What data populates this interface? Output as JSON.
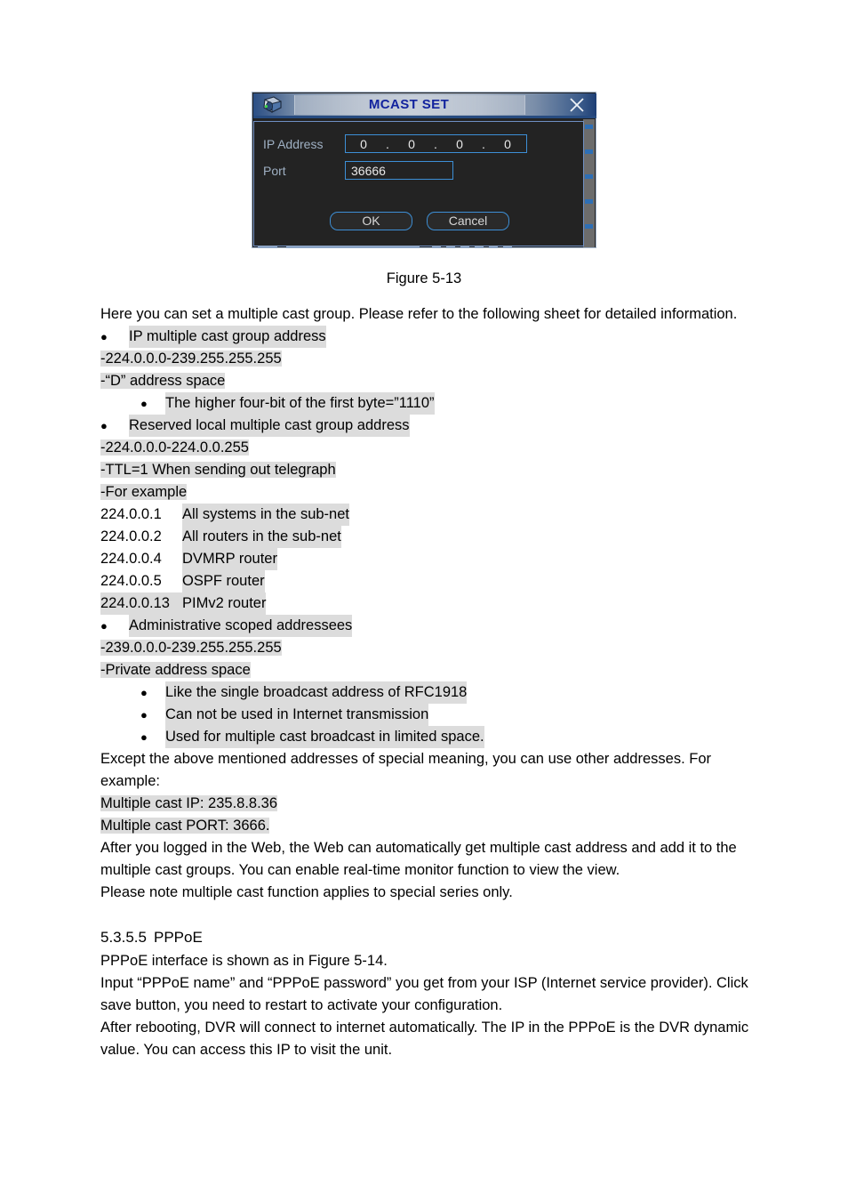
{
  "dialog": {
    "title": "MCAST SET",
    "icon": "network-device-icon",
    "close_icon": "close-icon",
    "fields": [
      {
        "label": "IP Address",
        "name": "ip-address",
        "type": "ip",
        "octets": [
          "0",
          "0",
          "0",
          "0"
        ],
        "separator": "."
      },
      {
        "label": "Port",
        "name": "port",
        "type": "text",
        "value": "36666"
      }
    ],
    "buttons": [
      {
        "label": "OK",
        "name": "ok-button"
      },
      {
        "label": "Cancel",
        "name": "cancel-button"
      }
    ],
    "colors": {
      "title_text": "#12239e",
      "field_border": "#3d8fd6",
      "panel_bg": "#232323",
      "label_text": "#9fb0c3"
    }
  },
  "figure_caption": "Figure 5-13",
  "body": {
    "intro": "Here you can set a multiple cast group. Please refer to the following sheet for detailed information.",
    "b1": "IP multiple cast group address",
    "l1": "-224.0.0.0-239.255.255.255",
    "l2": "-“D” address space",
    "b1a": "The higher four-bit of the first byte=”1110”",
    "b2": "Reserved local multiple cast group address",
    "l3": "-224.0.0.0-224.0.0.255",
    "l4": "-TTL=1 When sending out telegraph",
    "l5": "-For example",
    "addresses": [
      {
        "ip": "224.0.0.1",
        "desc": "All systems in the sub-net",
        "ip_highlighted": false
      },
      {
        "ip": "224.0.0.2",
        "desc": "All routers in the sub-net",
        "ip_highlighted": false
      },
      {
        "ip": "224.0.0.4",
        "desc": "DVMRP router",
        "ip_highlighted": false
      },
      {
        "ip": "224.0.0.5",
        "desc": "OSPF router",
        "ip_highlighted": false
      },
      {
        "ip": "224.0.0.13",
        "desc": "PIMv2 router",
        "ip_highlighted": true
      }
    ],
    "b3": "Administrative scoped addressees",
    "l6": "-239.0.0.0-239.255.255.255",
    "l7": "-Private address space",
    "b3a": "Like the single broadcast address of RFC1918",
    "b3b": "Can not be used in Internet transmission",
    "b3c": "Used for multiple cast broadcast in limited space.",
    "p_except": "Except the above mentioned addresses of special meaning, you can use other addresses. For example:",
    "mcast_ip": "Multiple cast IP: 235.8.8.36",
    "mcast_port": "Multiple cast PORT: 3666.",
    "p_after_login": "After you logged in the Web, the Web can automatically get multiple cast address and add it to the multiple cast groups. You can enable real-time monitor function to view the view.",
    "p_note": "Please note multiple cast function applies to special series only."
  },
  "section": {
    "number": "5.3.5.5",
    "title": "PPPoE",
    "p1": "PPPoE interface is shown as in Figure 5-14.",
    "p2": "Input “PPPoE name” and “PPPoE password” you get from your ISP (Internet service provider). Click save button, you need to restart to activate your configuration.",
    "p3": "After rebooting, DVR will connect to internet automatically. The IP in the PPPoE is the DVR dynamic value. You can access this IP to visit the unit."
  },
  "glyphs": {
    "bullet": "●",
    "dot": "."
  }
}
